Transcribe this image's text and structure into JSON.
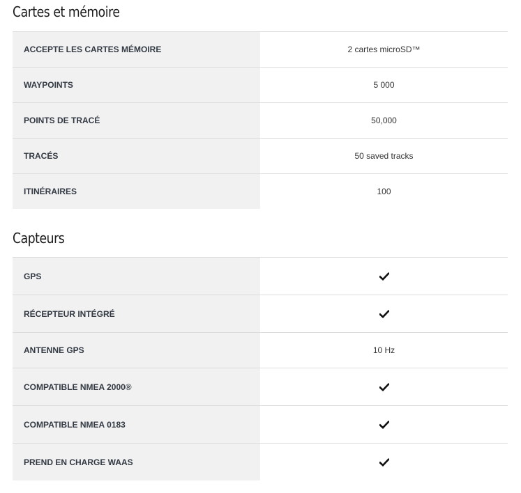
{
  "sections": [
    {
      "title": "Cartes et mémoire",
      "rows": [
        {
          "label": "ACCEPTE LES CARTES MÉMOIRE",
          "value": "2 cartes microSD™",
          "check": false
        },
        {
          "label": "WAYPOINTS",
          "value": "5 000",
          "check": false
        },
        {
          "label": "POINTS DE TRACÉ",
          "value": "50,000",
          "check": false
        },
        {
          "label": "TRACÉS",
          "value": "50 saved tracks",
          "check": false
        },
        {
          "label": "ITINÉRAIRES",
          "value": "100",
          "check": false
        }
      ]
    },
    {
      "title": "Capteurs",
      "rows": [
        {
          "label": "GPS",
          "value": "",
          "check": true
        },
        {
          "label": "RÉCEPTEUR INTÉGRÉ",
          "value": "",
          "check": true
        },
        {
          "label": "ANTENNE GPS",
          "value": "10 Hz",
          "check": false
        },
        {
          "label": "COMPATIBLE NMEA 2000®",
          "value": "",
          "check": true
        },
        {
          "label": "COMPATIBLE NMEA 0183",
          "value": "",
          "check": true
        },
        {
          "label": "PREND EN CHARGE WAAS",
          "value": "",
          "check": true
        }
      ]
    }
  ],
  "icons": {
    "supported": "check-icon"
  },
  "colors": {
    "label_background": "#f1f1f1",
    "divider": "#dcdcdc",
    "label_text": "#333a44"
  }
}
